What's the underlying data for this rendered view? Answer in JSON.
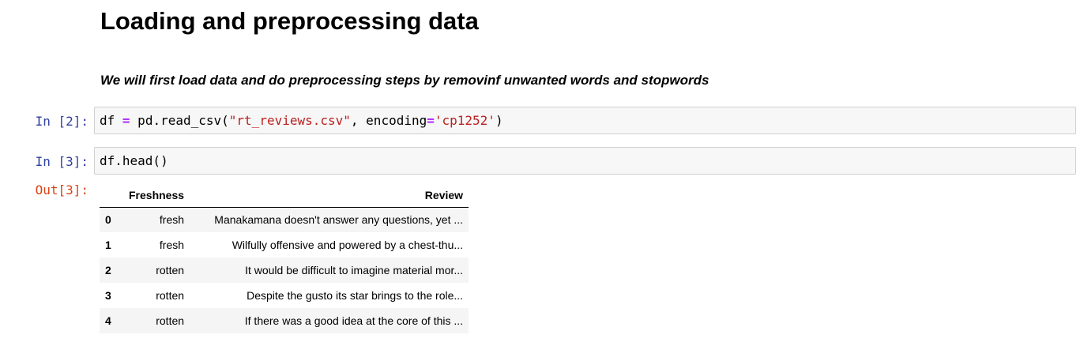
{
  "markdown": {
    "heading": "Loading and preprocessing data",
    "paragraph": "We will first load data and do preprocessing steps by removinf unwanted words and stopwords"
  },
  "cells": [
    {
      "prompt": "In [2]:",
      "code": {
        "var": "df",
        "op": "=",
        "call_start": " pd.read_csv(",
        "str1": "\"rt_reviews.csv\"",
        "mid": ", encoding",
        "op2": "=",
        "str2": "'cp1252'",
        "end": ")"
      }
    },
    {
      "prompt": "In [3]:",
      "code_text": "df.head()",
      "out_prompt": "Out[3]:"
    }
  ],
  "dataframe": {
    "columns": [
      "",
      "Freshness",
      "Review"
    ],
    "rows": [
      {
        "index": "0",
        "freshness": "fresh",
        "review": "Manakamana doesn't answer any questions, yet ..."
      },
      {
        "index": "1",
        "freshness": "fresh",
        "review": "Wilfully offensive and powered by a chest-thu..."
      },
      {
        "index": "2",
        "freshness": "rotten",
        "review": "It would be difficult to imagine material mor..."
      },
      {
        "index": "3",
        "freshness": "rotten",
        "review": "Despite the gusto its star brings to the role..."
      },
      {
        "index": "4",
        "freshness": "rotten",
        "review": "If there was a good idea at the core of this ..."
      }
    ]
  },
  "colors": {
    "in_prompt": "#303f9f",
    "out_prompt": "#d84315",
    "string": "#ba2121",
    "operator": "#aa22ff",
    "cell_bg": "#f7f7f7"
  }
}
